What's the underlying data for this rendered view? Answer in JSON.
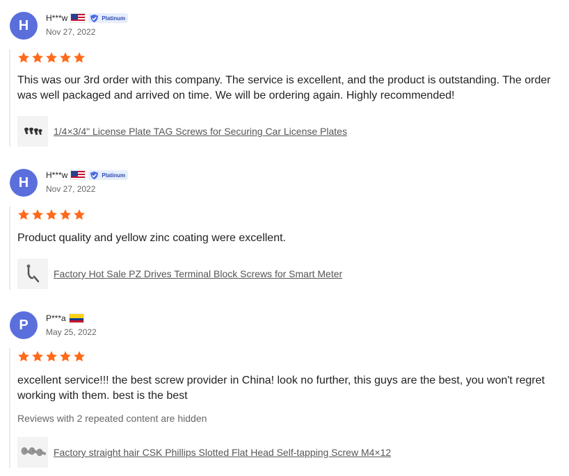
{
  "reviews": [
    {
      "avatar_letter": "H",
      "reviewer": "H***w",
      "flag": "us-flag",
      "badge": "Platinum",
      "date": "Nov 27, 2022",
      "stars": 5,
      "text": "This was our 3rd order with this company. The service is excellent, and the product is outstanding. The order was well packaged and arrived on time. We will be ordering again. Highly recommended!",
      "product": "1/4×3/4\" License Plate TAG Screws for Securing Car License Plates"
    },
    {
      "avatar_letter": "H",
      "reviewer": "H***w",
      "flag": "us-flag",
      "badge": "Platinum",
      "date": "Nov 27, 2022",
      "stars": 5,
      "text": "Product quality and yellow zinc coating were excellent.",
      "product": "Factory Hot Sale PZ Drives Terminal Block Screws for Smart Meter"
    },
    {
      "avatar_letter": "P",
      "reviewer": "P***a",
      "flag": "colombia-flag",
      "date": "May 25, 2022",
      "stars": 5,
      "text": "excellent service!!! the best screw provider in China! look no further, this guys are the best, you won't regret working with them. best is the best",
      "hidden_note": "Reviews with 2 repeated content are hidden",
      "product": "Factory straight hair CSK Phillips Slotted Flat Head Self-tapping Screw M4×12"
    }
  ],
  "colors": {
    "avatar": "#5b6fdc",
    "star": "#ff6a1a",
    "badge_bg": "#e7eefc",
    "badge_text": "#2d4bb0"
  }
}
